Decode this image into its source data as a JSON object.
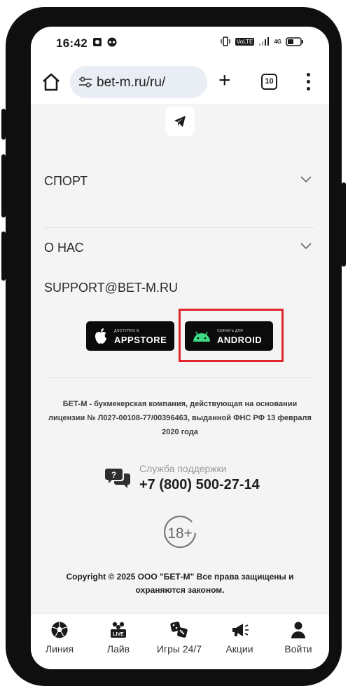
{
  "status": {
    "time": "16:42",
    "volte": "VoLTE",
    "network": "4G"
  },
  "browser": {
    "url": "bet-m.ru/ru/",
    "tab_count": "10"
  },
  "menu": {
    "items": [
      {
        "label": "СПОРТ"
      },
      {
        "label": "О НАС"
      }
    ],
    "email": "SUPPORT@BET-M.RU"
  },
  "stores": {
    "appstore_small": "Доступно в",
    "appstore_big": "APPSTORE",
    "android_small": "Скачать для",
    "android_big": "ANDROID"
  },
  "legal": {
    "text": "БЕТ-М - букмекерская компания, действующая на основании лицензии № Л027-00108-77/00396463, выданной ФНС РФ 13 февраля 2020 года"
  },
  "support": {
    "label": "Служба поддержки",
    "phone": "+7 (800) 500-27-14"
  },
  "age": "18+",
  "copyright": "Copyright © 2025 ООО \"БЕТ-М\" Все права защищены и охраняются законом.",
  "bottom_nav": [
    {
      "label": "Линия",
      "icon": "soccer-ball-icon"
    },
    {
      "label": "Лайв",
      "icon": "live-icon"
    },
    {
      "label": "Игры 24/7",
      "icon": "dice-icon"
    },
    {
      "label": "Акции",
      "icon": "megaphone-icon"
    },
    {
      "label": "Войти",
      "icon": "user-icon"
    }
  ],
  "colors": {
    "highlight": "#e0262c",
    "android_green": "#3ddc84",
    "page_bg": "#f4f4f4"
  }
}
